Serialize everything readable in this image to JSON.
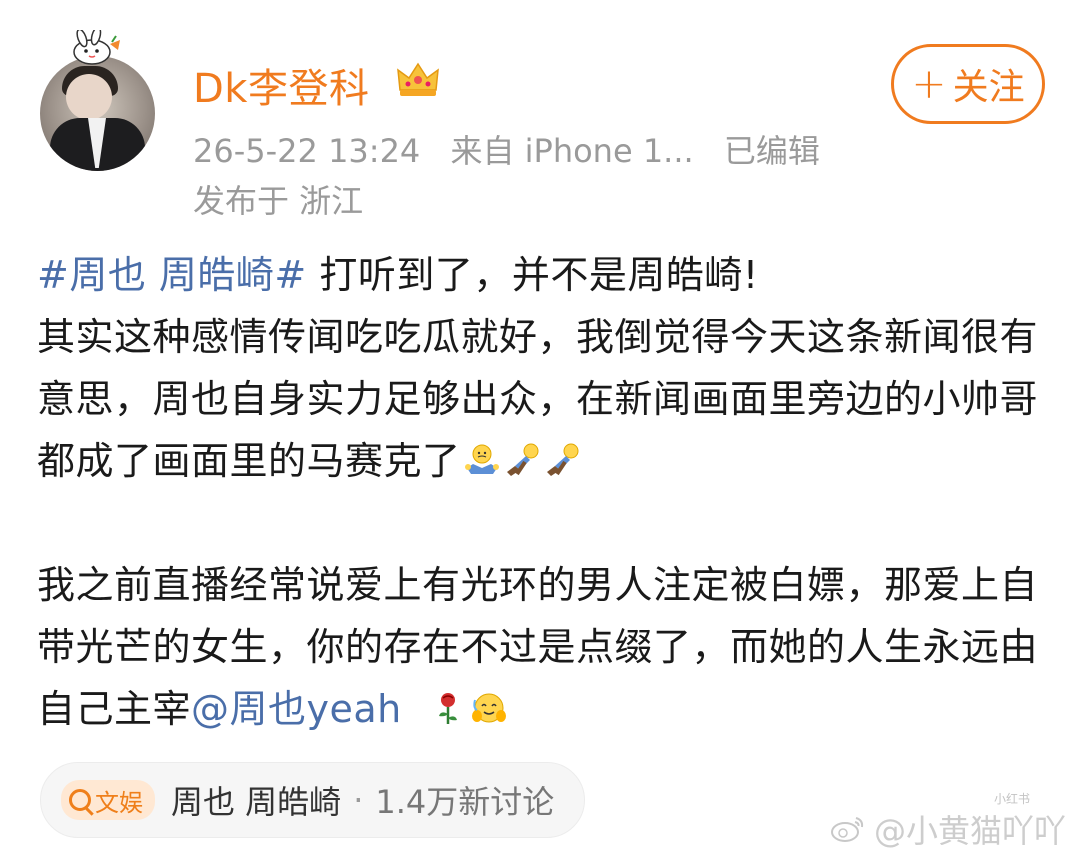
{
  "post": {
    "username": "Dk李登科",
    "crown_icon": "crown-icon",
    "timestamp": "26-5-22 13:24",
    "source": "来自 iPhone 1...",
    "edited": "已编辑",
    "location": "发布于 浙江",
    "follow_label": "关注",
    "follow_plus": "+",
    "accent_color": "#f07b1f",
    "link_color": "#4a6ea9"
  },
  "content": {
    "hashtag": "#周也 周皓崎#",
    "p1_rest": " 打听到了，并不是周皓崎!",
    "p1_line2": "其实这种感情传闻吃吃瓜就好，我倒觉得今天这条新闻很有意思，周也自身实力足够出众，在新闻画面里旁边的小帅哥都成了画面里的马赛克了",
    "p2": "我之前直播经常说爱上有光环的男人注定被白嫖，那爱上自带光芒的女生，你的存在不过是点缀了，而她的人生永远由自己主宰",
    "mention": "@周也yeah"
  },
  "topic": {
    "tag_label": "文娱",
    "title": "周也 周皓崎",
    "separator": "·",
    "count": "1.4万新讨论"
  },
  "watermark": {
    "text": "@小黄猫吖吖",
    "small": "小红书"
  }
}
